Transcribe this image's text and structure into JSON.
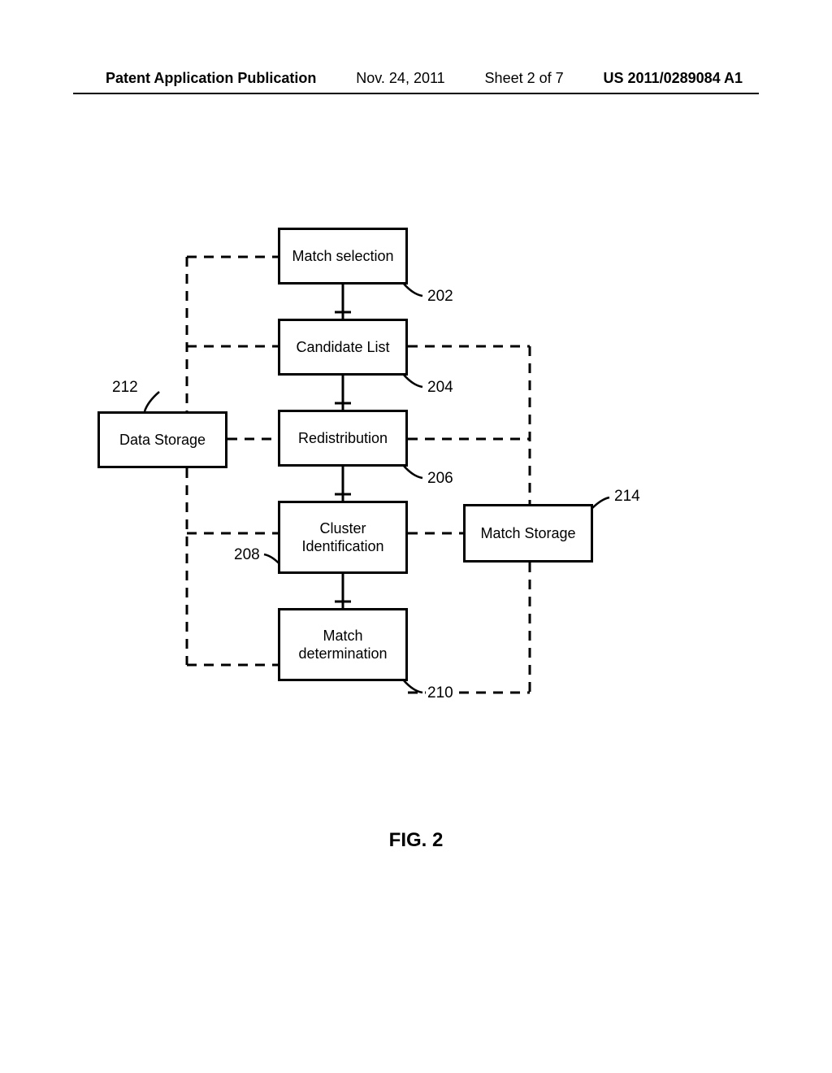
{
  "header": {
    "pub_type": "Patent Application Publication",
    "date": "Nov. 24, 2011",
    "sheet": "Sheet 2 of 7",
    "pub_no": "US 2011/0289084 A1"
  },
  "figure": {
    "caption": "FIG. 2",
    "boxes": {
      "match_selection": "Match selection",
      "candidate_list": "Candidate List",
      "redistribution": "Redistribution",
      "cluster_identification": "Cluster\nIdentification",
      "match_determination": "Match\ndetermination",
      "data_storage": "Data Storage",
      "match_storage": "Match Storage"
    },
    "refs": {
      "r202": "202",
      "r204": "204",
      "r206": "206",
      "r208": "208",
      "r210": "210",
      "r212": "212",
      "r214": "214"
    }
  }
}
